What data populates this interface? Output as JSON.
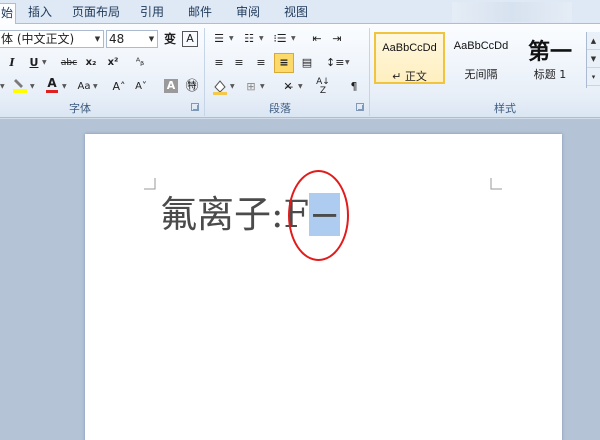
{
  "tabs": {
    "home": "始",
    "insert": "插入",
    "layout": "页面布局",
    "references": "引用",
    "mailings": "邮件",
    "review": "审阅",
    "view": "视图"
  },
  "font_group": {
    "font_name": "体 (中文正文)",
    "font_size": "48",
    "label": "字体",
    "font_color": "#e02020",
    "highlight_color": "#ffff00"
  },
  "paragraph_group": {
    "label": "段落"
  },
  "styles_group": {
    "label": "样式",
    "items": [
      {
        "sample": "AaBbCcDd",
        "name": "↵ 正文"
      },
      {
        "sample": "AaBbCcDd",
        "name": "无间隔"
      },
      {
        "sample": "第一",
        "name": "标题 1"
      }
    ]
  },
  "document": {
    "text_before": "氟离子:F",
    "selected_text": "−",
    "annotation_color": "#e21b1b"
  }
}
